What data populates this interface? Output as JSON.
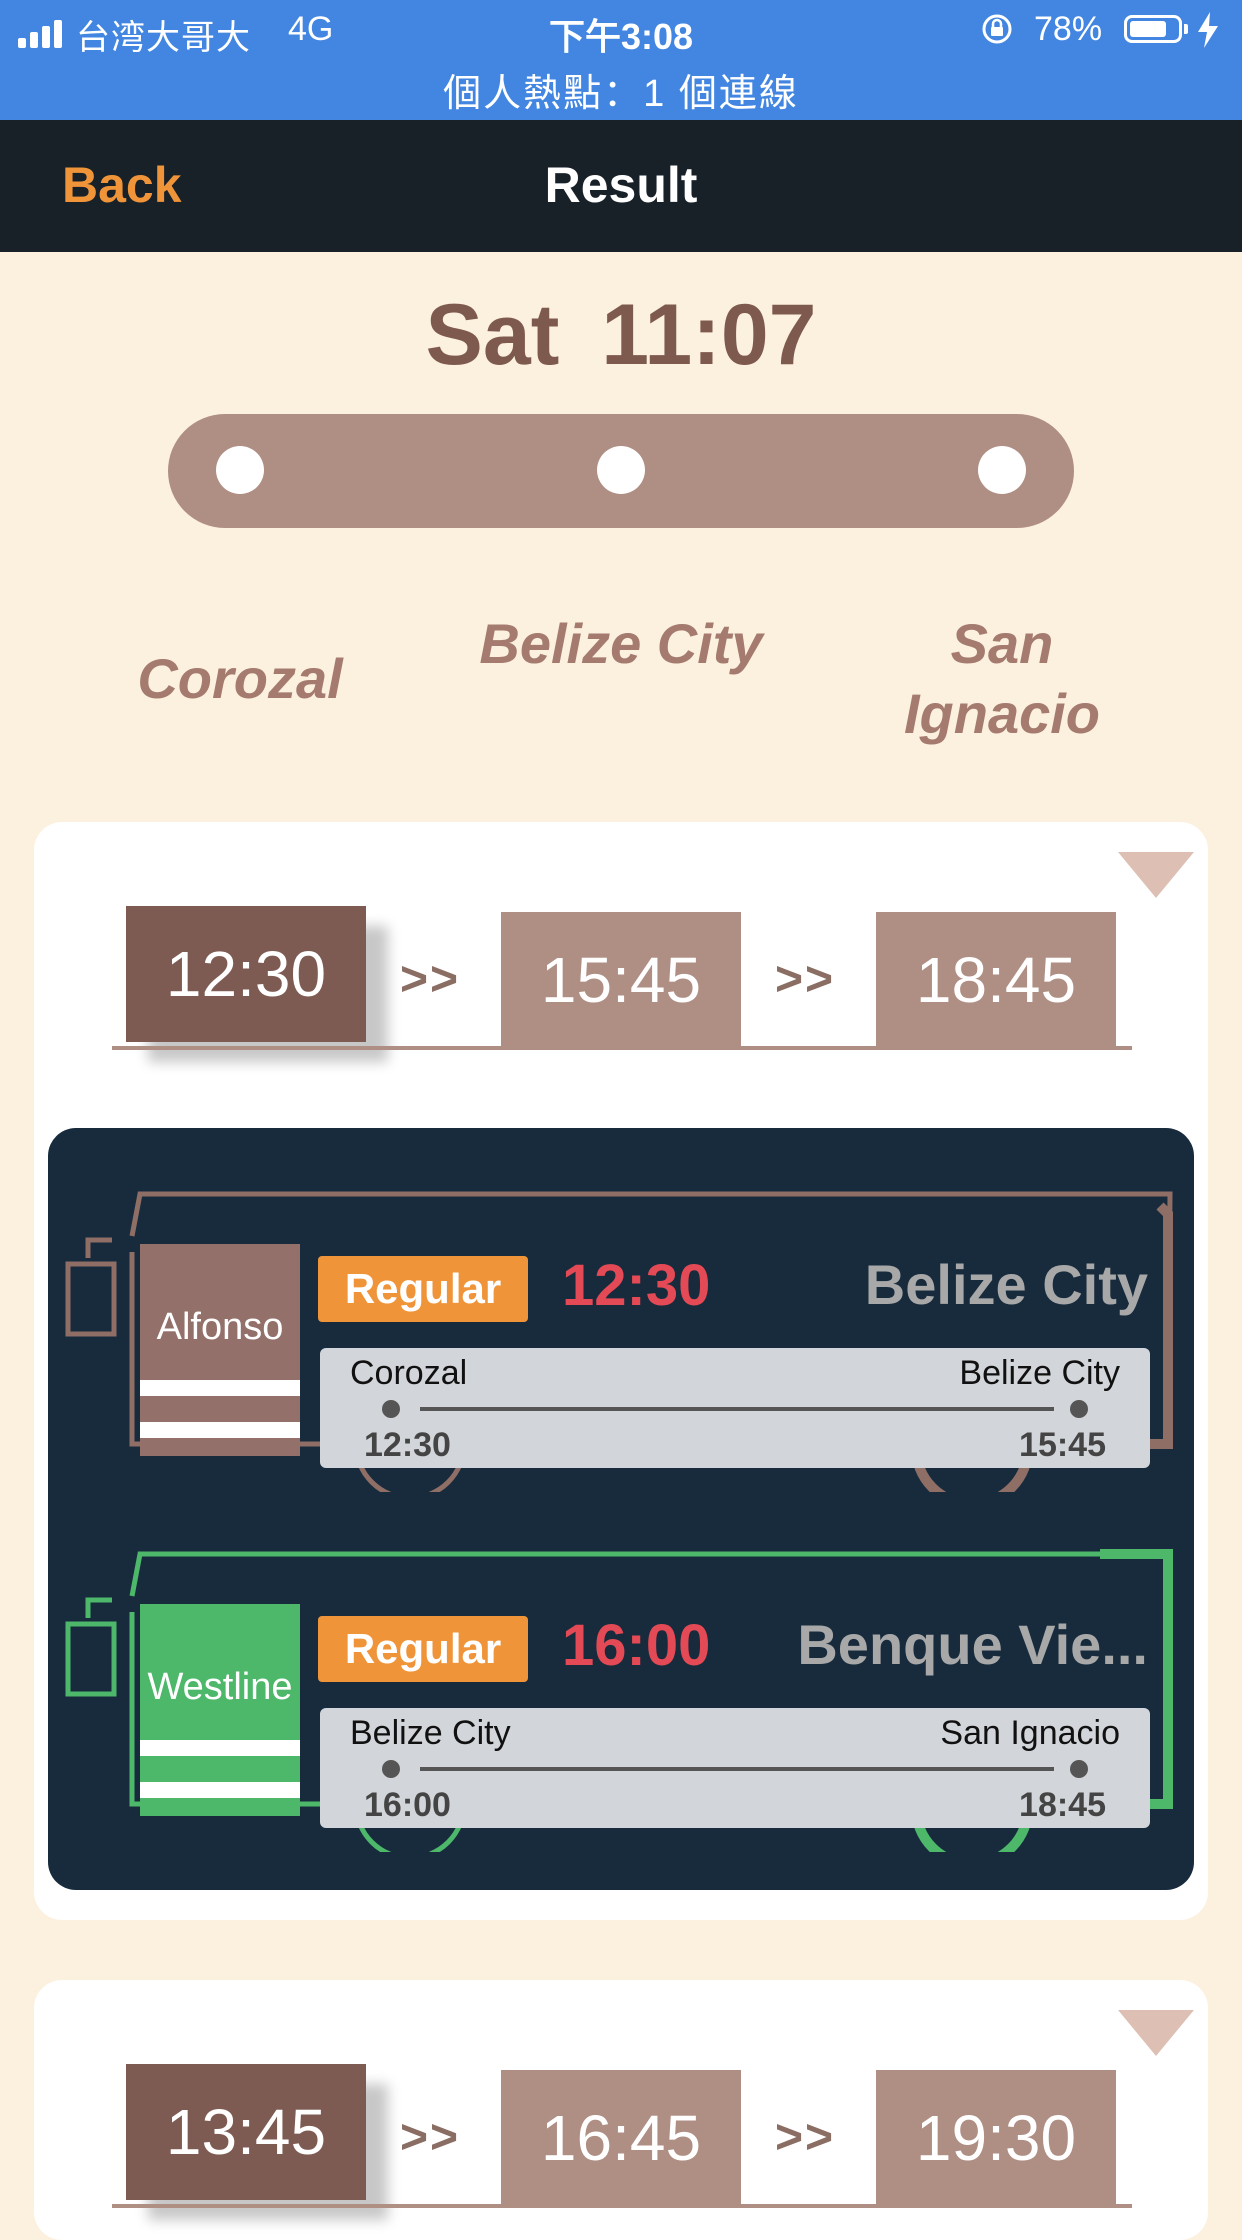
{
  "status_bar": {
    "carrier": "台湾大哥大",
    "network": "4G",
    "time": "下午3:08",
    "battery": "78%",
    "battery_level": 0.78,
    "hotspot": "個人熱點：1 個連線",
    "background_color": "#4286E1"
  },
  "nav": {
    "back_label": "Back",
    "title": "Result",
    "accent_color": "#F0943A"
  },
  "query": {
    "day": "Sat",
    "time": "11:07",
    "stops": [
      "Corozal",
      "Belize City",
      "San Ignacio"
    ]
  },
  "results": [
    {
      "times": [
        "12:30",
        "15:45",
        "18:45"
      ],
      "separator": ">>",
      "expanded": true,
      "legs": [
        {
          "company": "Alfonso",
          "company_color": "#94706A",
          "fare": "Regular",
          "departure": "12:30",
          "destination": "Belize City",
          "from": "Corozal",
          "to": "Belize City",
          "dep_time": "12:30",
          "arr_time": "15:45"
        },
        {
          "company": "Westline",
          "company_color": "#4DB76A",
          "fare": "Regular",
          "departure": "16:00",
          "destination": "Benque Vie...",
          "from": "Belize City",
          "to": "San Ignacio",
          "dep_time": "16:00",
          "arr_time": "18:45"
        }
      ]
    },
    {
      "times": [
        "13:45",
        "16:45",
        "19:30"
      ],
      "separator": ">>",
      "expanded": false
    }
  ]
}
